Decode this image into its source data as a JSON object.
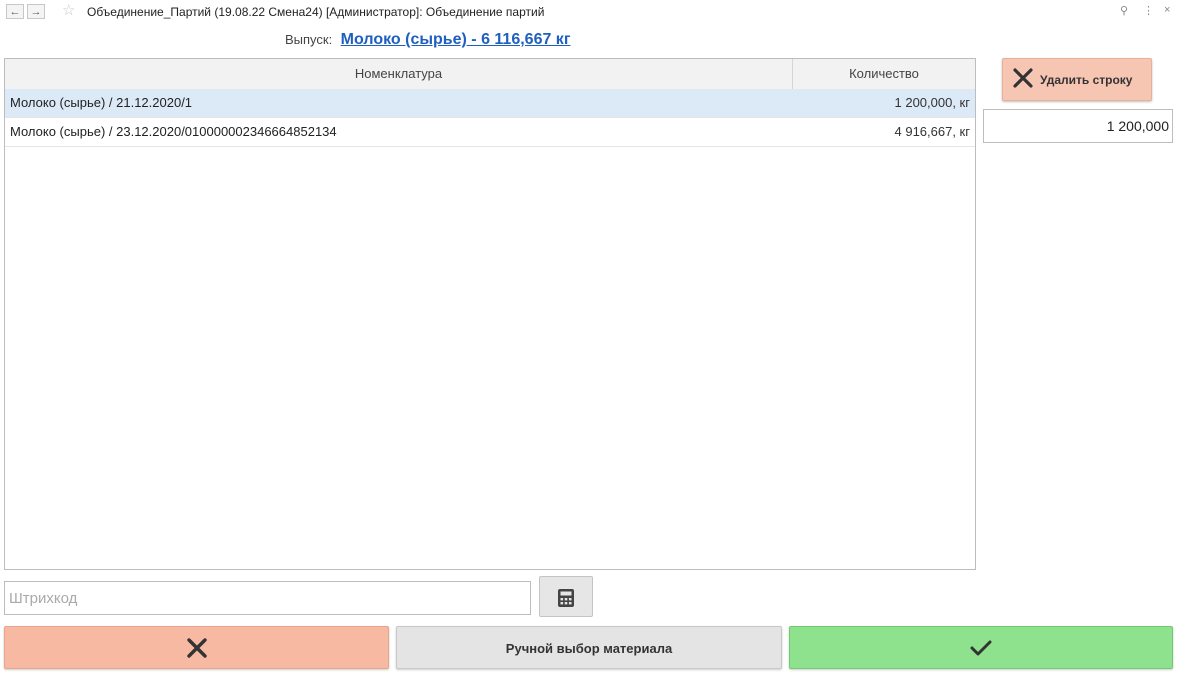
{
  "window": {
    "title": "Объединение_Партий (19.08.22 Смена24) [Администратор]: Объединение партий",
    "back_icon": "←",
    "forward_icon": "→",
    "star_icon": "☆",
    "link_icon": "⚲",
    "menu_icon": "⋮",
    "close_icon": "×"
  },
  "output": {
    "label": "Выпуск:",
    "value": "Молоко (сырье) - 6 116,667 кг"
  },
  "table": {
    "columns": [
      "Номенклатура",
      "Количество"
    ],
    "rows": [
      {
        "name": "Молоко (сырье) / 21.12.2020/1",
        "qty": "1 200,000, кг",
        "selected": true
      },
      {
        "name": "Молоко (сырье) / 23.12.2020/010000002346664852134",
        "qty": "4 916,667, кг",
        "selected": false
      }
    ]
  },
  "actions": {
    "delete_row_label": "Удалить строку",
    "quantity_value": "1 200,000",
    "barcode_placeholder": "Штрихкод",
    "manual_select_label": "Ручной выбор материала"
  },
  "colors": {
    "accent_link": "#1f5fbf",
    "delete_button": "#f7c6b3",
    "cancel_button": "#f7b9a1",
    "ok_button": "#8ee28e",
    "selected_row": "#dce9f7"
  }
}
